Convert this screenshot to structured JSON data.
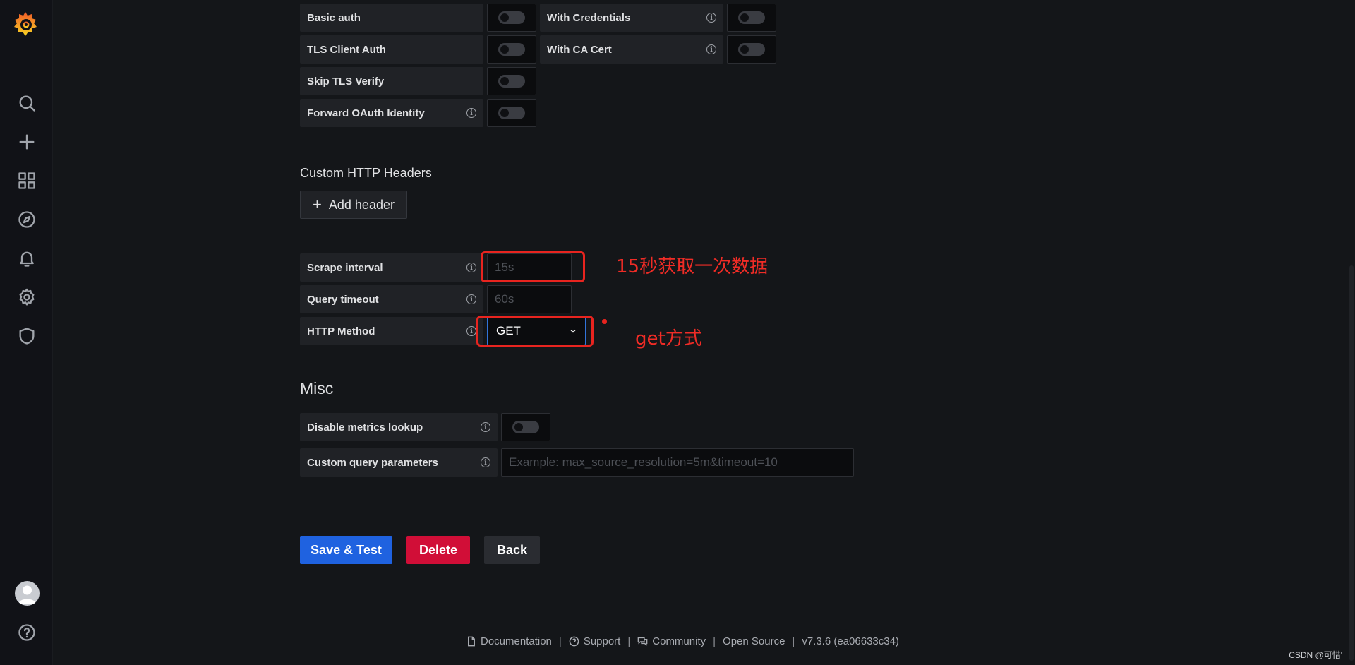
{
  "auth": {
    "basic_auth": "Basic auth",
    "with_credentials": "With Credentials",
    "tls_client_auth": "TLS Client Auth",
    "with_ca_cert": "With CA Cert",
    "skip_tls_verify": "Skip TLS Verify",
    "forward_oauth": "Forward OAuth Identity"
  },
  "headers": {
    "title": "Custom HTTP Headers",
    "add_header": "Add header"
  },
  "settings": {
    "scrape_interval_label": "Scrape interval",
    "scrape_interval_placeholder": "15s",
    "query_timeout_label": "Query timeout",
    "query_timeout_placeholder": "60s",
    "http_method_label": "HTTP Method",
    "http_method_value": "GET"
  },
  "misc": {
    "title": "Misc",
    "disable_metrics_lookup": "Disable metrics lookup",
    "custom_query_params": "Custom query parameters",
    "custom_query_placeholder": "Example: max_source_resolution=5m&timeout=10"
  },
  "actions": {
    "save_test": "Save & Test",
    "delete": "Delete",
    "back": "Back"
  },
  "annotations": {
    "scrape_note": "15秒获取一次数据",
    "method_note": "get方式"
  },
  "footer": {
    "documentation": "Documentation",
    "support": "Support",
    "community": "Community",
    "open_source": "Open Source",
    "version": "v7.3.6 (ea06633c34)",
    "separator": "|"
  },
  "watermark": "CSDN @可惜'",
  "colors": {
    "accent_blue": "#1f62e0",
    "danger_red": "#d10e37",
    "annotation_red": "#e8241f"
  }
}
